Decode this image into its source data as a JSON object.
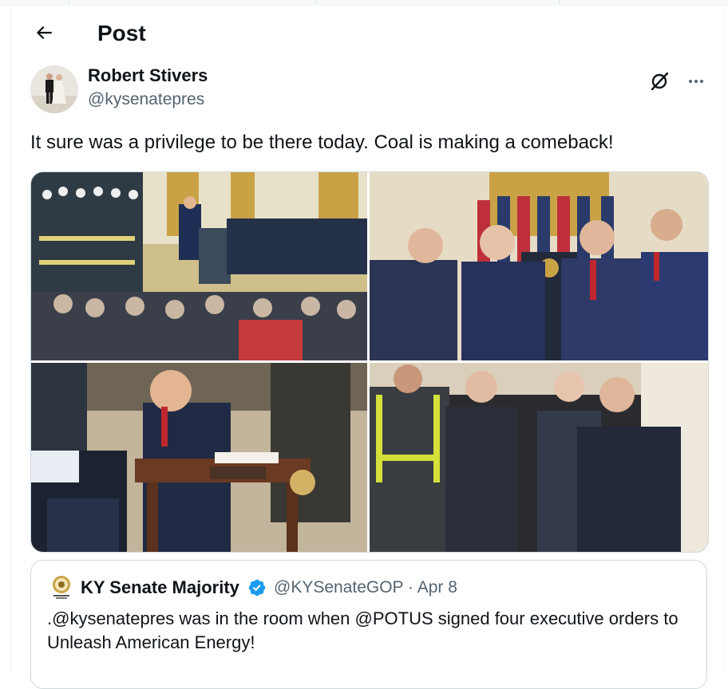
{
  "header": {
    "title": "Post"
  },
  "author": {
    "name": "Robert Stivers",
    "handle": "@kysenatepres"
  },
  "tweet": {
    "text": "It sure was a privilege to be there today. Coal is making a comeback!"
  },
  "media": {
    "photos": [
      {
        "id": "photo-1"
      },
      {
        "id": "photo-2"
      },
      {
        "id": "photo-3"
      },
      {
        "id": "photo-4"
      }
    ]
  },
  "quote": {
    "name": "KY Senate Majority",
    "handle": "@KYSenateGOP",
    "separator": "·",
    "date": "Apr 8",
    "text": ".@kysenatepres was in the room when @POTUS signed four executive orders to Unleash American Energy!"
  },
  "colors": {
    "text": "#0f1419",
    "secondary": "#536471",
    "border": "#cfd9de",
    "verified": "#1d9bf0"
  },
  "icons": [
    "back-arrow-icon",
    "grok-icon",
    "more-icon",
    "verified-badge-icon"
  ]
}
